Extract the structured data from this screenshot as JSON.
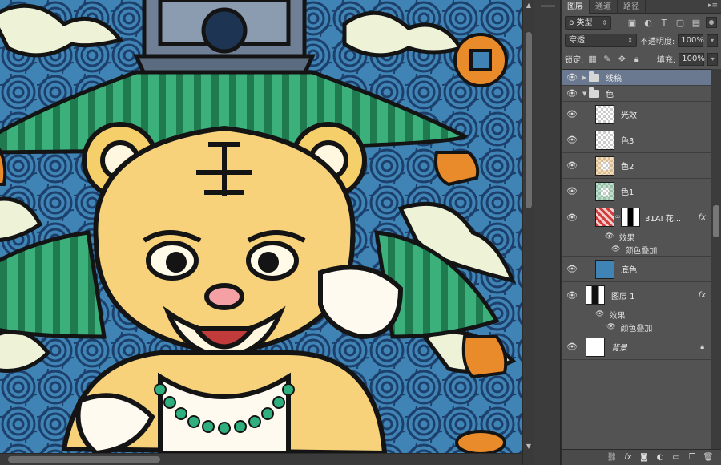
{
  "panel": {
    "tabs": [
      "图层",
      "通道",
      "路径"
    ],
    "filter": {
      "label": "ρ 类型"
    },
    "blend_mode": "穿透",
    "opacity_label": "不透明度:",
    "opacity_value": "100%",
    "lock_label": "锁定:",
    "fill_label": "填充:",
    "fill_value": "100%"
  },
  "layers": [
    {
      "name": "线稿",
      "kind": "group",
      "expanded": false,
      "selected": true
    },
    {
      "name": "色",
      "kind": "group",
      "expanded": true
    },
    {
      "name": "光效",
      "kind": "layer",
      "thumb": "checker"
    },
    {
      "name": "色3",
      "kind": "layer",
      "thumb": "checker"
    },
    {
      "name": "色2",
      "kind": "layer",
      "thumb": "checker-color"
    },
    {
      "name": "色1",
      "kind": "layer",
      "thumb": "checker-color"
    },
    {
      "name": "31AI 花...",
      "kind": "masked",
      "fx": "fx",
      "effects_label": "效果",
      "effect": "颜色叠加"
    },
    {
      "name": "底色",
      "kind": "layer",
      "thumb": "blue"
    },
    {
      "name": "图层 1",
      "kind": "layer",
      "thumb": "dark",
      "fx": "fx",
      "effects_label": "效果",
      "effect": "颜色叠加"
    },
    {
      "name": "背景",
      "kind": "background",
      "locked": true
    }
  ],
  "bottom_icons": [
    "link-icon",
    "fx-icon",
    "mask-icon",
    "adjustment-icon",
    "folder-icon",
    "new-layer-icon",
    "trash-icon"
  ],
  "colors": {
    "canvas_bg": "#3f84b5",
    "panel_bg": "#535353",
    "selected_row": "#6a7890"
  }
}
